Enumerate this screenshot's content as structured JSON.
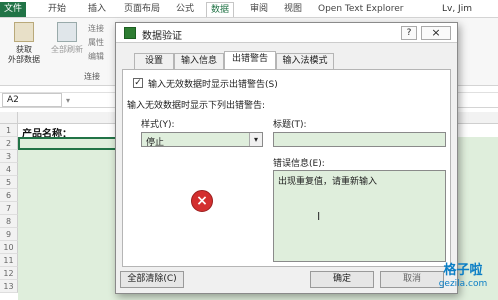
{
  "ribbon": {
    "tabs": [
      "文件",
      "开始",
      "插入",
      "页面布局",
      "公式",
      "数据",
      "审阅",
      "视图",
      "Open Text Explorer"
    ],
    "active_tab": "数据",
    "user": "Lv, Jim",
    "get_external": "获取\n外部数据",
    "refresh_all": "全部刷新",
    "connections": "连接",
    "properties": "属性",
    "edit_links": "编辑",
    "group_label": "连接"
  },
  "formula_bar": {
    "name_box": "A2"
  },
  "sheet": {
    "cell_a1": "产品名称：",
    "rows": [
      "1",
      "2",
      "3",
      "4",
      "5",
      "6",
      "7",
      "8",
      "9",
      "10",
      "11",
      "12",
      "13"
    ]
  },
  "dialog": {
    "title": "数据验证",
    "help": "?",
    "close": "×",
    "tabs": [
      "设置",
      "输入信息",
      "出错警告",
      "输入法模式"
    ],
    "active_tab": "出错警告",
    "checkbox_label": "输入无效数据时显示出错警告(S)",
    "checkbox_checked": true,
    "section_label": "输入无效数据时显示下列出错警告:",
    "style_label": "样式(Y):",
    "style_value": "停止",
    "title_label": "标题(T):",
    "title_value": "",
    "error_label": "错误信息(E):",
    "error_value": "出现重复值，请重新输入",
    "clear_all": "全部清除(C)",
    "ok": "确定",
    "cancel": "取消"
  },
  "watermark": {
    "brand": "格子啦",
    "url": "gezila.com"
  }
}
